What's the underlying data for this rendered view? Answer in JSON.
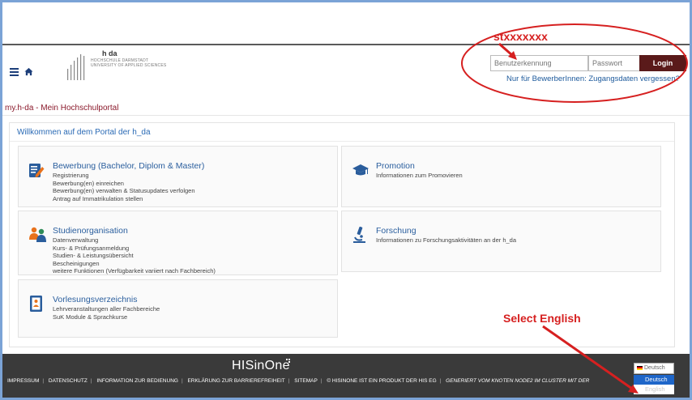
{
  "header": {
    "logo_hda": "h da",
    "logo_line1": "HOCHSCHULE DARMSTADT",
    "logo_line2": "UNIVERSITY OF APPLIED SCIENCES",
    "username_placeholder": "Benutzerkennung",
    "password_placeholder": "Passwort",
    "login_label": "Login",
    "forgot_link": "Nur für BewerberInnen: Zugangsdaten vergessen?"
  },
  "breadcrumb": "my.h-da - Mein Hochschulportal",
  "panel": {
    "welcome": "Willkommen auf dem Portal der h_da",
    "tiles": [
      {
        "title": "Bewerbung (Bachelor, Diplom & Master)",
        "icon": "edit-form-icon",
        "lines": [
          "Registrierung",
          "Bewerbung(en) einreichen",
          "Bewerbung(en) verwalten & Statusupdates verfolgen",
          "Antrag auf Immatrikulation stellen"
        ]
      },
      {
        "title": "Promotion",
        "icon": "graduation-cap-icon",
        "lines": [
          "Informationen zum Promovieren"
        ]
      },
      {
        "title": "Studienorganisation",
        "icon": "people-icon",
        "lines": [
          "Datenverwaltung",
          "Kurs- & Prüfungsanmeldung",
          "Studien- & Leistungsübersicht",
          "Bescheinigungen",
          "weitere Funktionen (Verfügbarkeit variiert nach Fachbereich)"
        ]
      },
      {
        "title": "Forschung",
        "icon": "microscope-icon",
        "lines": [
          "Informationen zu Forschungsaktivitäten an der h_da"
        ]
      },
      {
        "title": "Vorlesungsverzeichnis",
        "icon": "course-catalog-icon",
        "lines": [
          "Lehrveranstaltungen aller Fachbereiche",
          "SuK Module & Sprachkurse"
        ]
      }
    ]
  },
  "footer": {
    "brand": "HISinOne",
    "links": [
      "IMPRESSUM",
      "DATENSCHUTZ",
      "INFORMATION ZUR BEDIENUNG",
      "ERKLÄRUNG ZUR BARRIEREFREIHEIT",
      "SITEMAP",
      "© HISINONE IST EIN PRODUKT DER HIS EG"
    ],
    "generated": "GENERIERT VOM KNOTEN NODE2 IM CLUSTER MIT DER",
    "language_selected": "Deutsch",
    "language_options": [
      "Deutsch",
      "English"
    ]
  },
  "annotations": {
    "username_hint": "stxxxxxxx",
    "language_hint": "Select English",
    "color": "#d62020"
  }
}
